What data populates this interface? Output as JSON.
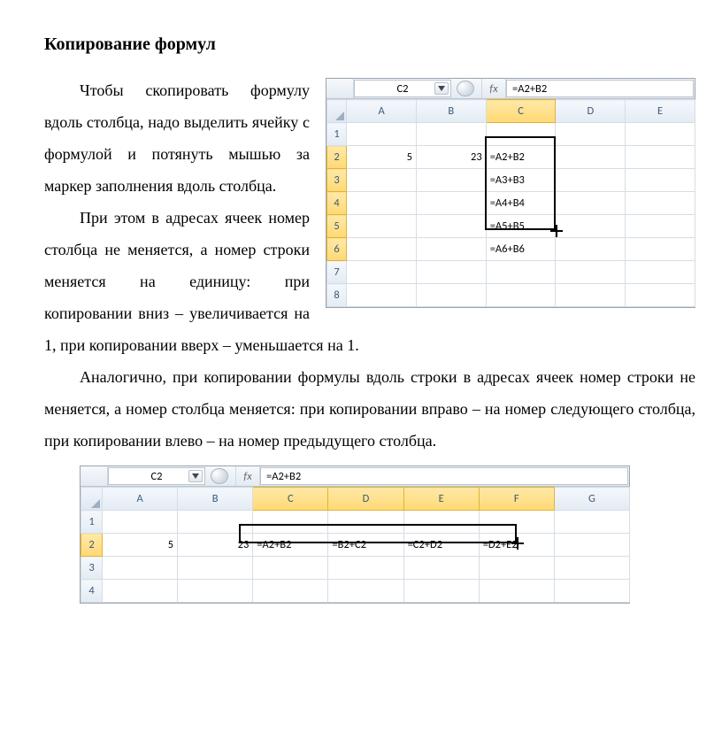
{
  "title": "Копирование формул",
  "para1_lead": "Чтобы скопировать формулу вдоль столбца, надо выделить ячейку с формулой и потянуть мышью за маркер заполнения вдоль столбца.",
  "para2": "При этом в адресах ячеек номер столбца не меняется, а номер строки меняется на единицу: при копировании вниз – увеличивается на 1, при копировании вверх – уменьшается на 1.",
  "para3": "Аналогично, при копировании формулы вдоль строки в адресах ячеек номер строки не меняется, а номер столбца меняется: при копировании вправо – на номер следующего столбца, при копировании влево – на номер предыдущего столбца.",
  "excel": {
    "name_box": "C2",
    "fx_label": "fx",
    "formula": "=A2+B2",
    "cols1": [
      "A",
      "B",
      "C",
      "D",
      "E"
    ],
    "cols2": [
      "A",
      "B",
      "C",
      "D",
      "E",
      "F",
      "G"
    ],
    "rows1": [
      "1",
      "2",
      "3",
      "4",
      "5",
      "6",
      "7",
      "8"
    ],
    "rows2": [
      "1",
      "2",
      "3",
      "4"
    ],
    "a2": "5",
    "b2": "23",
    "v_formulas": [
      "=A2+B2",
      "=A3+B3",
      "=A4+B4",
      "=A5+B5",
      "=A6+B6"
    ],
    "h_formulas": [
      "=A2+B2",
      "=B2+C2",
      "=C2+D2",
      "=D2+E2"
    ]
  }
}
